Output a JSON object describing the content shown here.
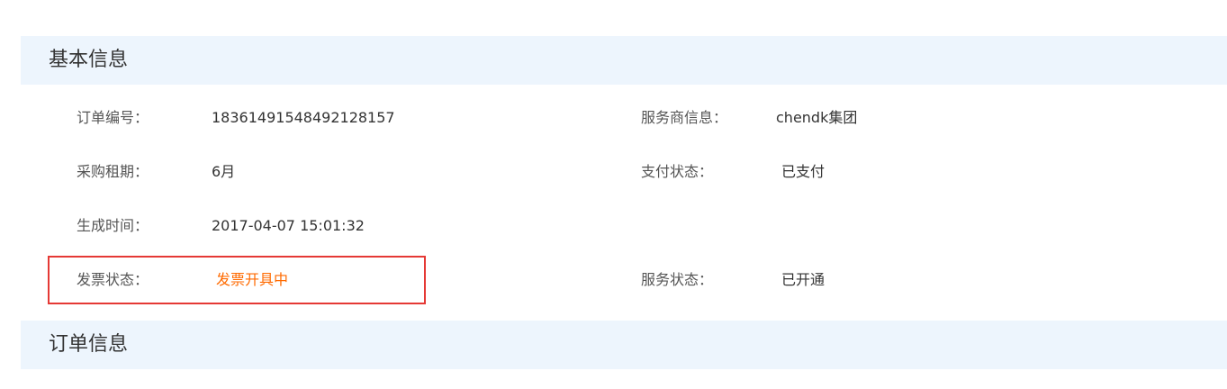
{
  "basic_info": {
    "title": "基本信息",
    "order_no": {
      "label": "订单编号：",
      "value": "18361491548492128157"
    },
    "provider": {
      "label": "服务商信息：",
      "value": "chendk集团"
    },
    "period": {
      "label": "采购租期：",
      "value": "6月"
    },
    "pay_status": {
      "label": "支付状态：",
      "value": "已支付"
    },
    "created_time": {
      "label": "生成时间：",
      "value": "2017-04-07 15:01:32"
    },
    "invoice_status": {
      "label": "发票状态：",
      "value": "发票开具中",
      "value_color": "#ff6a00",
      "highlight_color": "#e53935"
    },
    "service_status": {
      "label": "服务状态：",
      "value": "已开通"
    }
  },
  "order_info": {
    "title": "订单信息"
  },
  "colors": {
    "header_bg": "#edf5fd",
    "text": "#333333",
    "label": "#555555"
  }
}
